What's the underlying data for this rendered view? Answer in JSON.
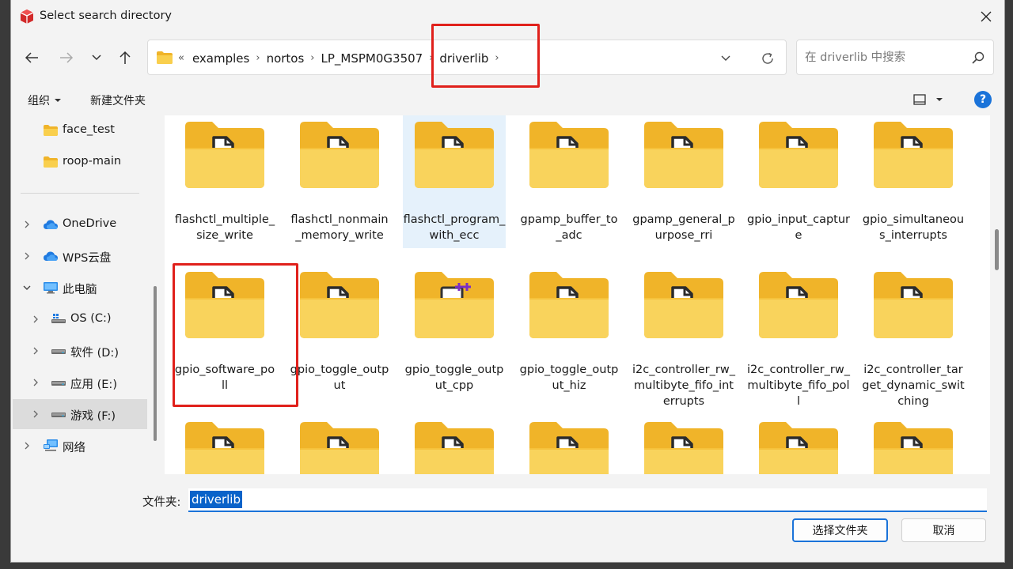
{
  "window": {
    "title": "Select search directory"
  },
  "address": {
    "lead": "«",
    "crumbs": [
      "examples",
      "nortos",
      "LP_MSPM0G3507",
      "driverlib"
    ],
    "sep": "›"
  },
  "search": {
    "placeholder": "在 driverlib 中搜索"
  },
  "toolbar": {
    "organize": "组织",
    "new_folder": "新建文件夹",
    "help": "?"
  },
  "sidebar": {
    "items": [
      {
        "label": "face_test",
        "icon": "folder-icon",
        "chev": false
      },
      {
        "label": "roop-main",
        "icon": "folder-icon",
        "chev": false
      },
      {
        "label": "OneDrive",
        "icon": "cloud-icon",
        "chev": true
      },
      {
        "label": "WPS云盘",
        "icon": "cloud-icon",
        "chev": true
      },
      {
        "label": "此电脑",
        "icon": "computer-icon",
        "chev": true,
        "expanded": true
      },
      {
        "label": "OS (C:)",
        "icon": "drive-icon",
        "chev": true
      },
      {
        "label": "软件 (D:)",
        "icon": "drive-icon",
        "chev": true
      },
      {
        "label": "应用 (E:)",
        "icon": "drive-icon",
        "chev": true
      },
      {
        "label": "游戏 (F:)",
        "icon": "drive-icon",
        "chev": true,
        "selected": true
      },
      {
        "label": "网络",
        "icon": "network-icon",
        "chev": true
      }
    ]
  },
  "folders": [
    {
      "name": "flashctl_multiple_size_write"
    },
    {
      "name": "flashctl_nonmain_memory_write"
    },
    {
      "name": "flashctl_program_with_ecc",
      "selected": true
    },
    {
      "name": "gpamp_buffer_to_adc"
    },
    {
      "name": "gpamp_general_purpose_rri"
    },
    {
      "name": "gpio_input_capture"
    },
    {
      "name": "gpio_simultaneous_interrupts"
    },
    {
      "name": "gpio_software_poll"
    },
    {
      "name": "gpio_toggle_output"
    },
    {
      "name": "gpio_toggle_output_cpp",
      "vs": true
    },
    {
      "name": "gpio_toggle_output_hiz"
    },
    {
      "name": "i2c_controller_rw_multibyte_fifo_interrupts"
    },
    {
      "name": "i2c_controller_rw_multibyte_fifo_poll"
    },
    {
      "name": "i2c_controller_target_dynamic_switching"
    },
    {
      "name": ""
    },
    {
      "name": ""
    },
    {
      "name": ""
    },
    {
      "name": ""
    },
    {
      "name": ""
    },
    {
      "name": ""
    },
    {
      "name": ""
    }
  ],
  "bottom": {
    "folder_label": "文件夹:",
    "folder_value": "driverlib",
    "select_button": "选择文件夹",
    "cancel_button": "取消"
  },
  "colors": {
    "accent": "#1a73d9",
    "annotation": "#e0201b",
    "folder": "#f6c644"
  }
}
